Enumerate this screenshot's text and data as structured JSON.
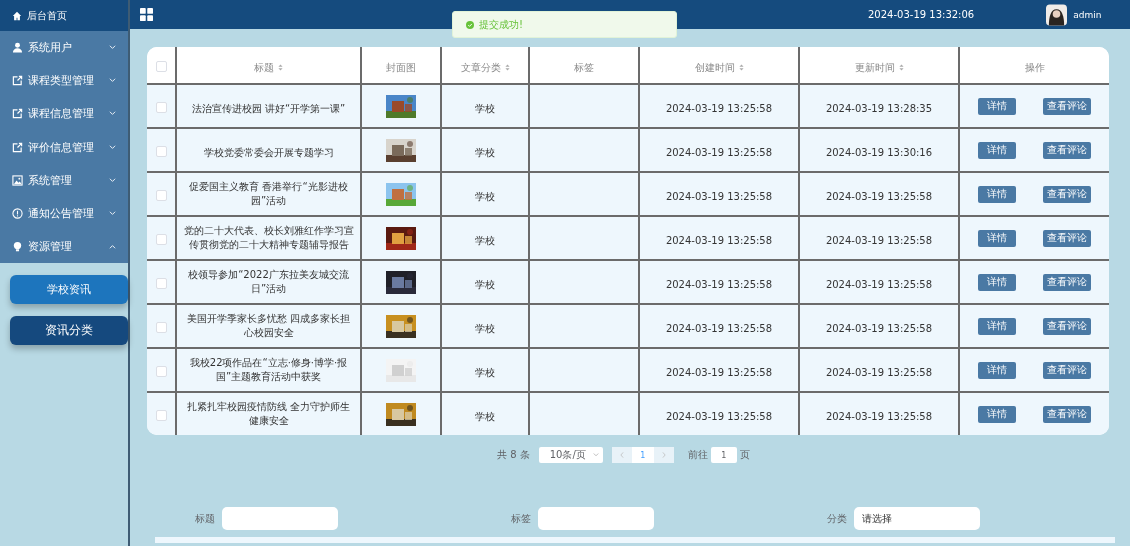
{
  "sidebar": {
    "home": {
      "label": "后台首页"
    },
    "items": [
      {
        "label": "系统用户",
        "expanded": false
      },
      {
        "label": "课程类型管理",
        "expanded": false
      },
      {
        "label": "课程信息管理",
        "expanded": false
      },
      {
        "label": "评价信息管理",
        "expanded": false
      },
      {
        "label": "系统管理",
        "expanded": false
      },
      {
        "label": "通知公告管理",
        "expanded": false
      },
      {
        "label": "资源管理",
        "expanded": true,
        "children": [
          {
            "label": "学校资讯",
            "selected": true
          },
          {
            "label": "资讯分类",
            "selected": false
          }
        ]
      }
    ]
  },
  "header": {
    "datetime": "2024-03-19 13:32:06",
    "user": "admin"
  },
  "toast": {
    "message": "提交成功!"
  },
  "table": {
    "all_checked": false,
    "columns": [
      {
        "label": "标题",
        "sortable": true
      },
      {
        "label": "封面图",
        "sortable": false
      },
      {
        "label": "文章分类",
        "sortable": true
      },
      {
        "label": "标签",
        "sortable": false
      },
      {
        "label": "创建时间",
        "sortable": true
      },
      {
        "label": "更新时间",
        "sortable": true
      },
      {
        "label": "操作",
        "sortable": false
      }
    ],
    "rows": [
      {
        "checked": false,
        "title": "法治宣传进校园 讲好“开学第一课”",
        "category": "学校",
        "created": "2024-03-19 13:25:58",
        "updated": "2024-03-19 13:28:35",
        "actions": [
          "详情",
          "查看评论"
        ]
      },
      {
        "checked": false,
        "title": "学校党委常委会开展专题学习",
        "category": "学校",
        "created": "2024-03-19 13:25:58",
        "updated": "2024-03-19 13:30:16",
        "actions": [
          "详情",
          "查看评论"
        ]
      },
      {
        "checked": false,
        "title": "促爱国主义教育 香港举行“光影进校园”活动",
        "category": "学校",
        "created": "2024-03-19 13:25:58",
        "updated": "2024-03-19 13:25:58",
        "actions": [
          "详情",
          "查看评论"
        ]
      },
      {
        "checked": false,
        "title": "党的二十大代表、校长刘雅红作学习宣传贯彻党的二十大精神专题辅导报告",
        "category": "学校",
        "created": "2024-03-19 13:25:58",
        "updated": "2024-03-19 13:25:58",
        "actions": [
          "详情",
          "查看评论"
        ]
      },
      {
        "checked": false,
        "title": "校领导参加“2022广东拉美友城交流日”活动",
        "category": "学校",
        "created": "2024-03-19 13:25:58",
        "updated": "2024-03-19 13:25:58",
        "actions": [
          "详情",
          "查看评论"
        ]
      },
      {
        "checked": false,
        "title": "美国开学季家长多忧愁 四成多家长担心校园安全",
        "category": "学校",
        "created": "2024-03-19 13:25:58",
        "updated": "2024-03-19 13:25:58",
        "actions": [
          "详情",
          "查看评论"
        ]
      },
      {
        "checked": false,
        "title": "我校22项作品在“立志·修身·博学·报国”主题教育活动中获奖",
        "category": "学校",
        "created": "2024-03-19 13:25:58",
        "updated": "2024-03-19 13:25:58",
        "actions": [
          "详情",
          "查看评论"
        ]
      },
      {
        "checked": false,
        "title": "扎紧扎牢校园疫情防线 全力守护师生健康安全",
        "category": "学校",
        "created": "2024-03-19 13:25:58",
        "updated": "2024-03-19 13:25:58",
        "actions": [
          "详情",
          "查看评论"
        ]
      }
    ]
  },
  "pagination": {
    "total": "共 8 条",
    "page_size": "10条/页",
    "pages": [
      {
        "label": "1",
        "selected": true
      }
    ],
    "goto_label": "前往",
    "goto_value": "1",
    "goto_suffix": "页"
  },
  "search": {
    "fields": [
      {
        "label": "标题",
        "kind": "input"
      },
      {
        "label": "标签",
        "kind": "input"
      },
      {
        "label": "分类",
        "kind": "select",
        "placeholder": "请选择"
      }
    ]
  }
}
